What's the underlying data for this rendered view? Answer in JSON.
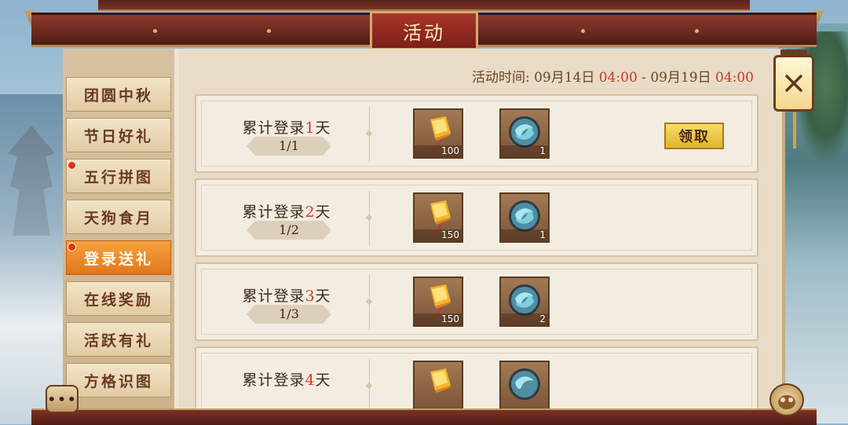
{
  "header": {
    "title": "活动"
  },
  "event_time": {
    "label": "活动时间:",
    "start_date": "09月14日",
    "start_time": "04:00",
    "separator": "-",
    "end_date": "09月19日",
    "end_time": "04:00"
  },
  "tabs": [
    {
      "label": "团圆中秋",
      "active": false,
      "badge": false
    },
    {
      "label": "节日好礼",
      "active": false,
      "badge": false
    },
    {
      "label": "五行拼图",
      "active": false,
      "badge": true
    },
    {
      "label": "天狗食月",
      "active": false,
      "badge": false
    },
    {
      "label": "登录送礼",
      "active": true,
      "badge": true
    },
    {
      "label": "在线奖励",
      "active": false,
      "badge": false
    },
    {
      "label": "活跃有礼",
      "active": false,
      "badge": false
    },
    {
      "label": "方格识图",
      "active": false,
      "badge": false
    }
  ],
  "rewards": [
    {
      "prefix": "累计登录",
      "day": "1",
      "suffix": "天",
      "progress": "1/1",
      "items": [
        {
          "icon": "sky-lantern-icon",
          "count": "100"
        },
        {
          "icon": "jade-orb-icon",
          "count": "1"
        }
      ],
      "claim_label": "领取"
    },
    {
      "prefix": "累计登录",
      "day": "2",
      "suffix": "天",
      "progress": "1/2",
      "items": [
        {
          "icon": "sky-lantern-icon",
          "count": "150"
        },
        {
          "icon": "jade-orb-icon",
          "count": "1"
        }
      ]
    },
    {
      "prefix": "累计登录",
      "day": "3",
      "suffix": "天",
      "progress": "1/3",
      "items": [
        {
          "icon": "sky-lantern-icon",
          "count": "150"
        },
        {
          "icon": "jade-orb-icon",
          "count": "2"
        }
      ]
    },
    {
      "prefix": "累计登录",
      "day": "4",
      "suffix": "天",
      "progress": "",
      "items": [
        {
          "icon": "sky-lantern-icon",
          "count": ""
        },
        {
          "icon": "jade-orb-icon",
          "count": ""
        }
      ]
    }
  ],
  "colors": {
    "accent_red": "#c4382b",
    "active_tab": "#e2761c",
    "claim_button": "#e3b52a",
    "frame_wood": "#6e2a20"
  }
}
